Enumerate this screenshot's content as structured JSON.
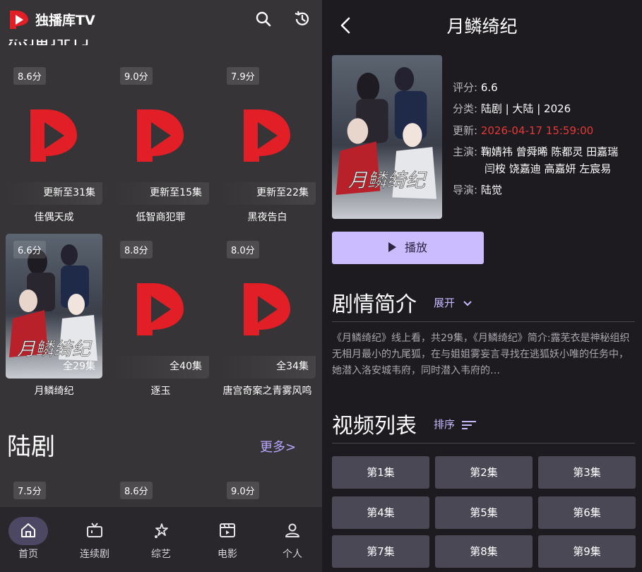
{
  "colors": {
    "accent": "#cbbcff",
    "brand_red": "#e21f26",
    "update_red": "#e53935",
    "more_link": "#b9a6ff"
  },
  "left": {
    "app_title": "独播库TV",
    "icons": {
      "logo": "play-logo-icon",
      "search": "search-icon",
      "history": "history-icon"
    },
    "cut_heading": "热播排行",
    "cards": [
      {
        "score": "8.6分",
        "badge": "更新至31集",
        "name": "佳偶天成"
      },
      {
        "score": "9.0分",
        "badge": "更新至15集",
        "name": "低智商犯罪"
      },
      {
        "score": "7.9分",
        "badge": "更新至22集",
        "name": "黑夜告白"
      },
      {
        "score": "6.6分",
        "badge": "全29集",
        "name": "月鳞绮纪",
        "poster_text": "月鳞绮纪"
      },
      {
        "score": "8.8分",
        "badge": "全40集",
        "name": "逐玉"
      },
      {
        "score": "8.0分",
        "badge": "全34集",
        "name": "唐宫奇案之青雾风鸣"
      }
    ],
    "section": {
      "title": "陆剧",
      "more": "更多>"
    },
    "section_scores": [
      "7.5分",
      "8.6分",
      "9.0分"
    ],
    "nav": [
      {
        "label": "首页",
        "icon": "home-icon"
      },
      {
        "label": "连续剧",
        "icon": "tv-icon"
      },
      {
        "label": "综艺",
        "icon": "star-icon"
      },
      {
        "label": "电影",
        "icon": "film-icon"
      },
      {
        "label": "个人",
        "icon": "user-icon"
      }
    ]
  },
  "right": {
    "title": "月鳞绮纪",
    "poster_text": "月鳞绮纪",
    "info": {
      "rating_label": "评分:",
      "rating": "6.6",
      "category_label": "分类:",
      "category": "陆剧 | 大陆 | 2026",
      "update_label": "更新:",
      "update": "2026-04-17 15:59:00",
      "cast_label": "主演:",
      "cast_line1": "鞠婧祎 曾舜晞 陈都灵 田嘉瑞",
      "cast_line2": "闫桉 饶嘉迪 高嘉妍 左宸易",
      "director_label": "导演:",
      "director": "陆觉"
    },
    "play_label": "播放",
    "synopsis_title": "剧情简介",
    "expand_label": "展开",
    "synopsis": "《月鳞绮纪》线上看，共29集，《月鳞绮纪》简介:露芜衣是神秘组织无相月最小的九尾狐，在与姐姐雾妄言寻找在逃狐妖小唯的任务中，她潜入洛安城韦府，同时潜入韦府的…",
    "episodes_title": "视频列表",
    "sort_label": "排序",
    "episodes": [
      "第1集",
      "第2集",
      "第3集",
      "第4集",
      "第5集",
      "第6集",
      "第7集",
      "第8集",
      "第9集"
    ]
  }
}
